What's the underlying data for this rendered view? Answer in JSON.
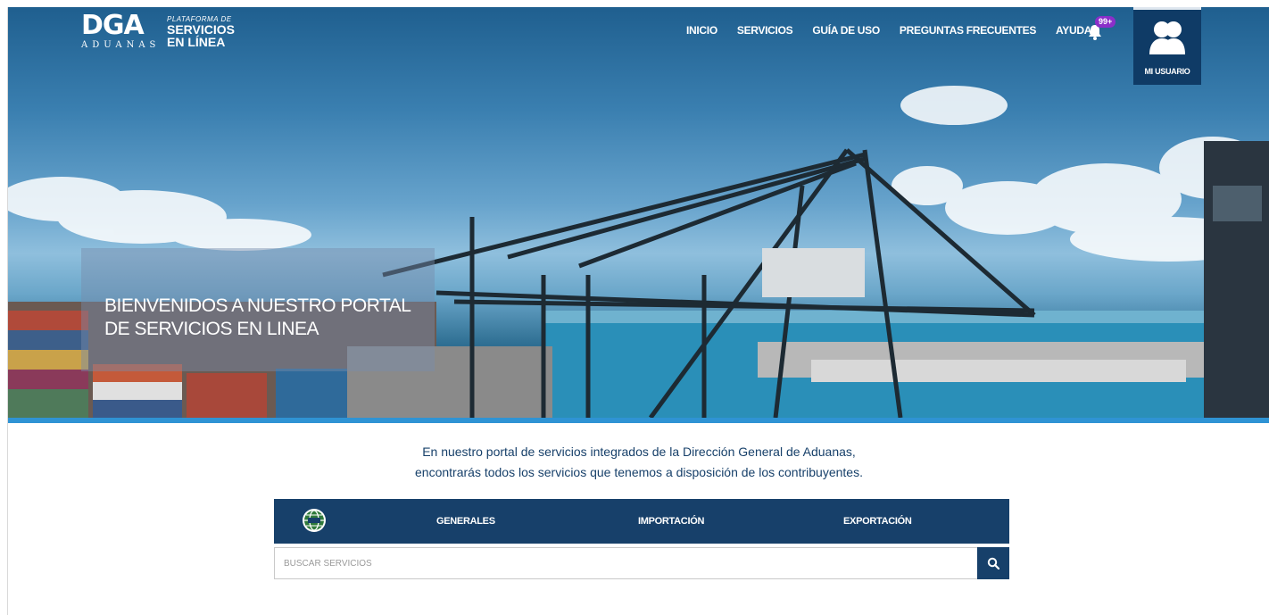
{
  "header": {
    "logo": {
      "mark": "DGA",
      "subtitle": "ADUANAS",
      "tagline": "PLATAFORMA DE",
      "line1": "SERVICIOS",
      "line2": "EN LÍNEA"
    },
    "nav": [
      "INICIO",
      "SERVICIOS",
      "GUÍA DE USO",
      "PREGUNTAS FRECUENTES",
      "AYUDA"
    ],
    "notifications_badge": "99+",
    "user_label": "MI USUARIO"
  },
  "hero": {
    "title_line1": "BIENVENIDOS A NUESTRO PORTAL",
    "title_line2": "DE SERVICIOS EN LINEA"
  },
  "intro": {
    "line1": "En nuestro portal de servicios integrados de la Dirección General de Aduanas,",
    "line2": "encontrarás todos los servicios que tenemos a disposición de los contribuyentes."
  },
  "tabs": [
    "GENERALES",
    "IMPORTACIÓN",
    "EXPORTACIÓN"
  ],
  "search": {
    "placeholder": "BUSCAR SERVICIOS"
  },
  "icons": {
    "bell": "bell-icon",
    "user": "users-icon",
    "globe": "globe-icon",
    "search": "search-icon"
  },
  "colors": {
    "navy": "#17406a",
    "user_box": "#0f3b66",
    "accent_bar": "#2f93d4",
    "badge": "#8b2fc9"
  }
}
